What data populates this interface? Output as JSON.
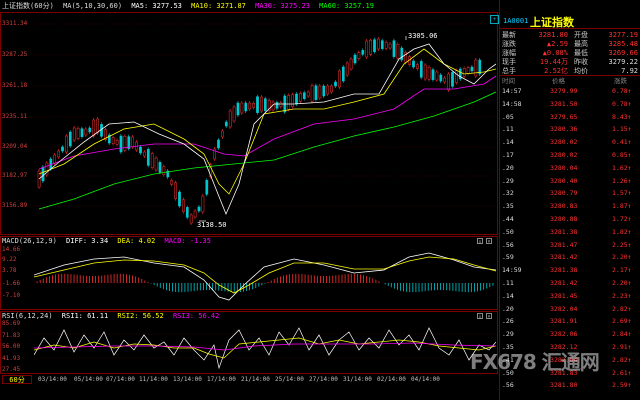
{
  "main": {
    "title": "上证指数",
    "period": "(60分)",
    "ma_label": "MA(5,10,30,60)",
    "ma5": "MA5: 3277.53",
    "ma10": "MA10: 3271.87",
    "ma30": "MA30: 3275.23",
    "ma60": "MA60: 3257.19",
    "y_ticks": [
      "3311.34",
      "3287.25",
      "3261.18",
      "3235.11",
      "3209.04",
      "3182.97",
      "3156.89"
    ],
    "high_label": "3305.06",
    "low_label": "3138.50"
  },
  "macd": {
    "label": "MACD(26,12,9)",
    "diff": "DIFF: 3.34",
    "dea": "DEA: 4.02",
    "macd": "MACD: -1.35",
    "y_ticks": [
      "14.66",
      "9.22",
      "3.78",
      "-1.66",
      "-7.10"
    ]
  },
  "rsi": {
    "label": "RSI(6,12,24)",
    "rsi1": "RSI1: 61.11",
    "rsi2": "RSI2: 56.52",
    "rsi3": "RSI3: 56.42",
    "y_ticks": [
      "85.69",
      "71.83",
      "56.00",
      "41.93",
      "27.45"
    ]
  },
  "xaxis": {
    "period_tag": "60分",
    "dates": [
      "03/14:00",
      "05/14:00",
      "07/14:00",
      "11/14:00",
      "13/14:00",
      "17/14:00",
      "21/14:00",
      "25/14:00",
      "27/14:00",
      "31/14:00",
      "02/14:00",
      "04/14:00"
    ]
  },
  "quote": {
    "code": "1A0001",
    "name": "上证指数",
    "rows": [
      {
        "l1": "最新",
        "v1": "3281.80",
        "l2": "开盘",
        "v2": "3277.19"
      },
      {
        "l1": "涨跌",
        "v1": "▲2.59",
        "l2": "最高",
        "v2": "3285.48"
      },
      {
        "l1": "涨幅",
        "v1": "▲0.08%",
        "l2": "最低",
        "v2": "3269.66"
      },
      {
        "l1": "现手",
        "v1": "19.44万",
        "l2": "昨收",
        "v2": "3279.22"
      },
      {
        "l1": "总手",
        "v1": "2.52亿",
        "l2": "均价",
        "v2": "7.92"
      }
    ]
  },
  "ticks": {
    "headers": [
      "时间",
      "价格",
      "涨跌"
    ],
    "rows": [
      {
        "t": "14:57",
        "p": "3279.99",
        "c": "0.78↑"
      },
      {
        "t": "14:58",
        "p": "3281.50",
        "c": "0.78↑"
      },
      {
        "t": ".05",
        "p": "3279.65",
        "c": "8.43↑"
      },
      {
        "t": ".11",
        "p": "3280.36",
        "c": "1.15↑"
      },
      {
        "t": ".14",
        "p": "3280.02",
        "c": "0.41↑"
      },
      {
        "t": ".17",
        "p": "3280.02",
        "c": "0.85↑"
      },
      {
        "t": ".20",
        "p": "3280.04",
        "c": "1.62↑"
      },
      {
        "t": ".29",
        "p": "3280.40",
        "c": "1.26↑"
      },
      {
        "t": ".32",
        "p": "3280.79",
        "c": "1.57↑"
      },
      {
        "t": ".35",
        "p": "3280.83",
        "c": "1.87↑"
      },
      {
        "t": ".44",
        "p": "3280.88",
        "c": "1.72↑"
      },
      {
        "t": ".50",
        "p": "3281.38",
        "c": "1.82↑"
      },
      {
        "t": ".56",
        "p": "3281.47",
        "c": "2.25↑"
      },
      {
        "t": ".59",
        "p": "3281.42",
        "c": "2.20↑"
      },
      {
        "t": "14:59",
        "p": "3281.38",
        "c": "2.17↑"
      },
      {
        "t": ".11",
        "p": "3281.42",
        "c": "2.20↑"
      },
      {
        "t": ".14",
        "p": "3281.45",
        "c": "2.23↑"
      },
      {
        "t": ".20",
        "p": "3282.04",
        "c": "2.82↑"
      },
      {
        "t": ".26",
        "p": "3281.91",
        "c": "2.69↑"
      },
      {
        "t": ".29",
        "p": "3282.06",
        "c": "2.84↑"
      },
      {
        "t": ".35",
        "p": "3282.12",
        "c": "2.91↑"
      },
      {
        "t": ".41",
        "p": "3282.04",
        "c": "2.82↑"
      },
      {
        "t": ".50",
        "p": "3281.83",
        "c": "2.61↑"
      },
      {
        "t": ".56",
        "p": "3281.80",
        "c": "2.59↑"
      }
    ]
  },
  "watermark": "FX678 汇通网",
  "colors": {
    "up": "#ff3030",
    "down": "#00c8d0",
    "ma5": "#ffffff",
    "ma10": "#ffff00",
    "ma30": "#ff00ff",
    "ma60": "#00ff00",
    "border": "#7a0000"
  }
}
